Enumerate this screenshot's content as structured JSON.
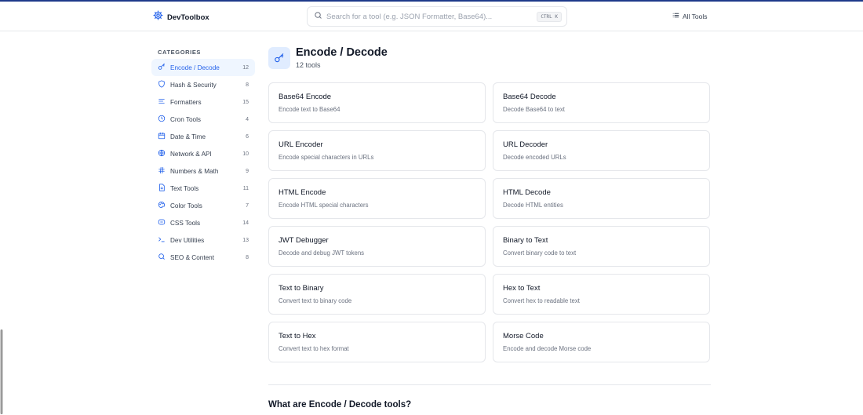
{
  "header": {
    "brand": "DevToolbox",
    "search_placeholder": "Search for a tool (e.g. JSON Formatter, Base64)...",
    "shortcut": "CTRL K",
    "all_tools": "All Tools"
  },
  "sidebar": {
    "heading": "CATEGORIES",
    "items": [
      {
        "label": "Encode / Decode",
        "count": "12",
        "icon": "key-icon",
        "active": true
      },
      {
        "label": "Hash & Security",
        "count": "8",
        "icon": "shield-icon"
      },
      {
        "label": "Formatters",
        "count": "15",
        "icon": "align-left-icon"
      },
      {
        "label": "Cron Tools",
        "count": "4",
        "icon": "clock-icon"
      },
      {
        "label": "Date & Time",
        "count": "6",
        "icon": "calendar-icon"
      },
      {
        "label": "Network & API",
        "count": "10",
        "icon": "globe-icon"
      },
      {
        "label": "Numbers & Math",
        "count": "9",
        "icon": "hash-icon"
      },
      {
        "label": "Text Tools",
        "count": "11",
        "icon": "file-text-icon"
      },
      {
        "label": "Color Tools",
        "count": "7",
        "icon": "palette-icon"
      },
      {
        "label": "CSS Tools",
        "count": "14",
        "icon": "code-icon"
      },
      {
        "label": "Dev Utilities",
        "count": "13",
        "icon": "terminal-icon"
      },
      {
        "label": "SEO & Content",
        "count": "8",
        "icon": "search-icon"
      }
    ]
  },
  "main": {
    "title": "Encode / Decode",
    "subtitle": "12 tools",
    "tools": [
      {
        "name": "Base64 Encode",
        "desc": "Encode text to Base64"
      },
      {
        "name": "Base64 Decode",
        "desc": "Decode Base64 to text"
      },
      {
        "name": "URL Encoder",
        "desc": "Encode special characters in URLs"
      },
      {
        "name": "URL Decoder",
        "desc": "Decode encoded URLs"
      },
      {
        "name": "HTML Encode",
        "desc": "Encode HTML special characters"
      },
      {
        "name": "HTML Decode",
        "desc": "Decode HTML entities"
      },
      {
        "name": "JWT Debugger",
        "desc": "Decode and debug JWT tokens"
      },
      {
        "name": "Binary to Text",
        "desc": "Convert binary code to text"
      },
      {
        "name": "Text to Binary",
        "desc": "Convert text to binary code"
      },
      {
        "name": "Hex to Text",
        "desc": "Convert hex to readable text"
      },
      {
        "name": "Text to Hex",
        "desc": "Convert text to hex format"
      },
      {
        "name": "Morse Code",
        "desc": "Encode and decode Morse code"
      }
    ],
    "section_title": "What are Encode / Decode tools?"
  },
  "colors": {
    "accent": "#2563eb",
    "active_bg": "#eff6ff",
    "border": "#e5e7eb"
  }
}
